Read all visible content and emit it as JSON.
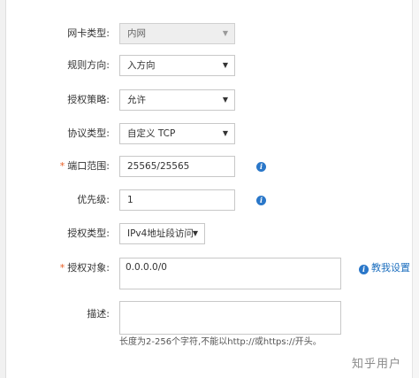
{
  "form": {
    "nic_type": {
      "label": "网卡类型:",
      "value": "内网"
    },
    "direction": {
      "label": "规则方向:",
      "value": "入方向"
    },
    "policy": {
      "label": "授权策略:",
      "value": "允许"
    },
    "protocol": {
      "label": "协议类型:",
      "value": "自定义 TCP"
    },
    "port_range": {
      "required": "*",
      "label": "端口范围:",
      "value": "25565/25565"
    },
    "priority": {
      "label": "优先级:",
      "value": "1"
    },
    "auth_type": {
      "label": "授权类型:",
      "value": "IPv4地址段访问"
    },
    "auth_object": {
      "required": "*",
      "label": "授权对象:",
      "value": "0.0.0.0/0",
      "help_link": "教我设置"
    },
    "description": {
      "label": "描述:",
      "value": "",
      "hint": "长度为2-256个字符,不能以http://或https://开头。"
    }
  },
  "icons": {
    "info": "i",
    "caret": "▼"
  },
  "watermark": "知乎用户",
  "colors": {
    "required": "#e85b21",
    "link": "#1d6fbf",
    "info_icon": "#2a77c9"
  }
}
